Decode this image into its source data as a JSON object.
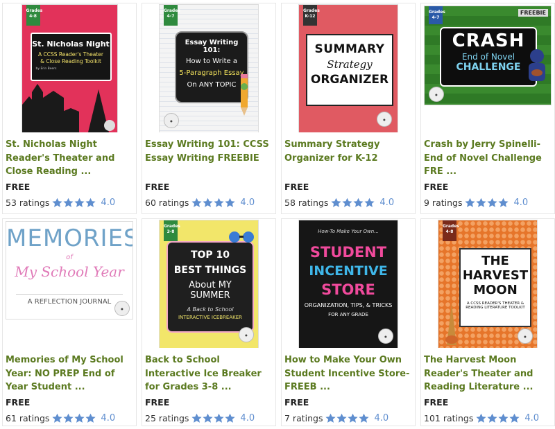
{
  "products": [
    {
      "title": "St. Nicholas Night Reader's Theater and Close Reading ...",
      "price": "FREE",
      "ratings_count": "53 ratings",
      "rating": "4.0",
      "cover": {
        "grade": "Grades 4-8",
        "heading": "St. Nicholas Night",
        "sub": "A CCSS Reader's Theater & Close Reading Toolkit",
        "byline": "by Erin Beers"
      }
    },
    {
      "title": "Essay Writing 101: CCSS Essay Writing FREEBIE",
      "price": "FREE",
      "ratings_count": "60 ratings",
      "rating": "4.0",
      "cover": {
        "grade": "Grades 4-7",
        "lines": [
          "Essay Writing 101:",
          "How to Write a",
          "5-Paragraph Essay",
          "On ANY TOPIC"
        ]
      }
    },
    {
      "title": "Summary Strategy Organizer for K-12",
      "price": "FREE",
      "ratings_count": "58 ratings",
      "rating": "4.0",
      "cover": {
        "grade": "Grades K-12",
        "lines": [
          "SUMMARY",
          "Strategy",
          "ORGANIZER"
        ]
      }
    },
    {
      "title": "Crash by Jerry Spinelli-End of Novel Challenge FRE ...",
      "price": "FREE",
      "ratings_count": "9 ratings",
      "rating": "4.0",
      "cover": {
        "grade": "Grades 4-7",
        "tag": "FREEBIE",
        "heading": "CRASH",
        "sub1": "End of Novel",
        "sub2": "CHALLENGE"
      }
    },
    {
      "title": "Memories of My School Year: NO PREP End of Year Student ...",
      "price": "FREE",
      "ratings_count": "61 ratings",
      "rating": "4.0",
      "cover": {
        "l1": "MEMORIES",
        "l2": "of",
        "l3": "My School Year",
        "l4": "A REFLECTION JOURNAL"
      }
    },
    {
      "title": "Back to School Interactive Ice Breaker for Grades 3-8 ...",
      "price": "FREE",
      "ratings_count": "25 ratings",
      "rating": "4.0",
      "cover": {
        "grade": "Grades 3-8",
        "lines": [
          "TOP 10",
          "BEST THINGS",
          "About MY SUMMER",
          "A Back to School",
          "INTERACTIVE ICEBREAKER"
        ]
      }
    },
    {
      "title": "How to Make Your Own Student Incentive Store-FREEB ...",
      "price": "FREE",
      "ratings_count": "7 ratings",
      "rating": "4.0",
      "cover": {
        "lines": [
          "How-To Make Your Own...",
          "STUDENT",
          "INCENTIVE",
          "STORE",
          "ORGANIZATION, TIPS, & TRICKS",
          "FOR ANY GRADE"
        ]
      }
    },
    {
      "title": "The Harvest Moon Reader's Theater and Reading Literature ...",
      "price": "FREE",
      "ratings_count": "101 ratings",
      "rating": "4.0",
      "cover": {
        "grade": "Grades 4-8",
        "lines": [
          "THE",
          "HARVEST",
          "MOON",
          "A CCSS READER'S THEATER &",
          "READING LITERATURE TOOLKIT"
        ]
      }
    }
  ],
  "colors": {
    "title": "#5b7a20",
    "rating_score": "#5f8ecf",
    "star": "#5f8ecf"
  },
  "icons": {
    "star": "star-icon"
  }
}
